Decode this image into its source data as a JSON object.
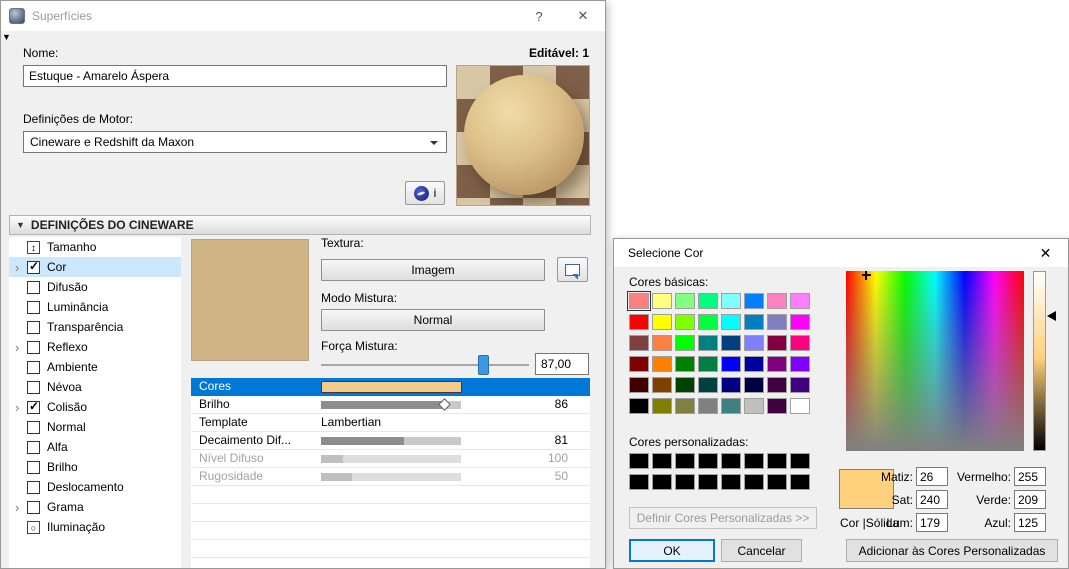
{
  "colors": {
    "selection": "#0078d7",
    "tree-highlight": "#cce8ff",
    "slider-thumb": "#3b99e0"
  },
  "surfaces_dialog": {
    "title": "Superfícies",
    "help_icon": "?",
    "close_icon": "✕",
    "collapse_icon": "▼",
    "name_label": "Nome:",
    "editable_label": "Editável: 1",
    "name_value": "Estuque - Amarelo Áspera",
    "engine_label": "Definições de Motor:",
    "engine_value": "Cineware e Redshift da Maxon",
    "info_label": "i",
    "section_collapse_icon": "▼",
    "section_title": "DEFINIÇÕES DO CINEWARE",
    "texture_color": "#cfb486",
    "tree_items": [
      {
        "label": "Tamanho",
        "icon": "size"
      },
      {
        "label": "Cor",
        "chevron": true,
        "checked": true,
        "selected": true
      },
      {
        "label": "Difusão",
        "checked": false
      },
      {
        "label": "Luminância",
        "checked": false
      },
      {
        "label": "Transparência",
        "checked": false
      },
      {
        "label": "Reflexo",
        "chevron": true,
        "checked": false
      },
      {
        "label": "Ambiente",
        "checked": false
      },
      {
        "label": "Névoa",
        "checked": false
      },
      {
        "label": "Colisão",
        "chevron": true,
        "checked": true
      },
      {
        "label": "Normal",
        "checked": false
      },
      {
        "label": "Alfa",
        "checked": false
      },
      {
        "label": "Brilho",
        "checked": false
      },
      {
        "label": "Deslocamento",
        "checked": false
      },
      {
        "label": "Grama",
        "chevron": true,
        "checked": false
      },
      {
        "label": "Iluminação",
        "icon": "lamp"
      }
    ],
    "texture": {
      "label": "Textura:",
      "image_button": "Imagem",
      "blend_mode_label": "Modo Mistura:",
      "blend_mode_value": "Normal",
      "strength_label": "Força Mistura:",
      "strength_value": "87,00",
      "strength_percent": 78
    },
    "properties": [
      {
        "label": "Cores",
        "kind": "color",
        "swatch": "#F2CA8A",
        "selected": true
      },
      {
        "label": "Brilho",
        "kind": "slider",
        "value": "86",
        "fill": 88,
        "marker": true
      },
      {
        "label": "Template",
        "kind": "text",
        "value": "Lambertian"
      },
      {
        "label": "Decaimento Dif...",
        "kind": "slider",
        "value": "81",
        "fill": 59
      },
      {
        "label": "Nível Difuso",
        "kind": "slider",
        "value": "100",
        "fill": 16,
        "disabled": true
      },
      {
        "label": "Rugosidade",
        "kind": "slider",
        "value": "50",
        "fill": 22,
        "disabled": true
      }
    ]
  },
  "color_dialog": {
    "title": "Selecione Cor",
    "close_icon": "✕",
    "basic_label": "Cores básicas:",
    "basic_colors": [
      "#FF8080",
      "#FFFF80",
      "#80FF80",
      "#00FF80",
      "#80FFFF",
      "#0080FF",
      "#FF80C0",
      "#FF80FF",
      "#FF0000",
      "#FFFF00",
      "#80FF00",
      "#00FF40",
      "#00FFFF",
      "#0080C0",
      "#8080C0",
      "#FF00FF",
      "#804040",
      "#FF8040",
      "#00FF00",
      "#008080",
      "#004080",
      "#8080FF",
      "#800040",
      "#FF0080",
      "#800000",
      "#FF8000",
      "#008000",
      "#008040",
      "#0000FF",
      "#0000A0",
      "#800080",
      "#8000FF",
      "#400000",
      "#804000",
      "#004000",
      "#004040",
      "#000080",
      "#000040",
      "#400040",
      "#400080",
      "#000000",
      "#808000",
      "#808040",
      "#808080",
      "#408080",
      "#C0C0C0",
      "#400040",
      "#FFFFFF"
    ],
    "selected_basic_index": 0,
    "custom_label": "Cores personalizadas:",
    "custom_colors": [
      "#000000",
      "#000000",
      "#000000",
      "#000000",
      "#000000",
      "#000000",
      "#000000",
      "#000000",
      "#000000",
      "#000000",
      "#000000",
      "#000000",
      "#000000",
      "#000000",
      "#000000",
      "#000000"
    ],
    "define_button": "Definir Cores Personalizadas >>",
    "ok_button": "OK",
    "cancel_button": "Cancelar",
    "add_button": "Adicionar às Cores Personalizadas",
    "solid_label": "Cor |Sólida",
    "selected_color": "#FFD17D",
    "hue_marker_left_pct": 11,
    "lum_arrow_top_pct": 25,
    "hsl_fields": [
      {
        "label": "Matiz:",
        "value": "26"
      },
      {
        "label": "Sat:",
        "value": "240"
      },
      {
        "label": "Lum:",
        "value": "179"
      }
    ],
    "rgb_fields": [
      {
        "label": "Vermelho:",
        "value": "255"
      },
      {
        "label": "Verde:",
        "value": "209"
      },
      {
        "label": "Azul:",
        "value": "125"
      }
    ]
  }
}
